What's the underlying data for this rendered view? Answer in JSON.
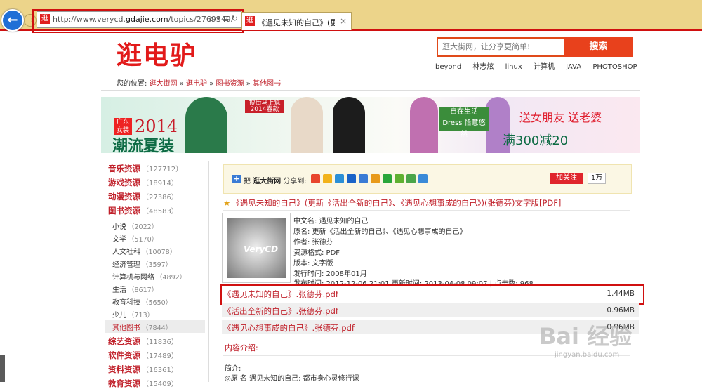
{
  "browser": {
    "url_prefix": "http://www.verycd.",
    "url_domain": "gdajie.com",
    "url_path": "/topics/2769349/",
    "tab_title": "《遇见未知的自己》(更新…",
    "back_glyph": "←",
    "forward_glyph": "→",
    "close_glyph": "×",
    "favicon_text": "逛",
    "addr_tools": "ρ ▾ ≣ ↻"
  },
  "header": {
    "logo": "逛电驴",
    "search_placeholder": "逛大街网，让分享更简单!",
    "search_button": "搜索",
    "hotwords": [
      "beyond",
      "林志炫",
      "linux",
      "计算机",
      "JAVA",
      "PHOTOSHOP"
    ]
  },
  "breadcrumb": {
    "prefix": "您的位置:",
    "items": [
      "逛大街网",
      "逛电驴",
      "图书资源",
      "其他图书"
    ],
    "separator": " » "
  },
  "banner": {
    "tag": "广东女装",
    "year": "2014",
    "title": "潮流夏装",
    "promo": "搜街马上疯 2014春款",
    "mid_text": "自在生活 Dress 恰意悠然",
    "right_line1": "送女朋友  送老婆",
    "right_line2": "满300减20"
  },
  "sidebar": {
    "categories": [
      {
        "name": "音乐资源",
        "count": "（127712）"
      },
      {
        "name": "游戏资源",
        "count": "（18914）"
      },
      {
        "name": "动漫资源",
        "count": "（27386）"
      },
      {
        "name": "图书资源",
        "count": "（48583）"
      }
    ],
    "subcategories": [
      {
        "name": "小说",
        "count": "（2022）"
      },
      {
        "name": "文学",
        "count": "（5170）"
      },
      {
        "name": "人文社科",
        "count": "（10078）"
      },
      {
        "name": "经济管理",
        "count": "（3597）"
      },
      {
        "name": "计算机与网络",
        "count": "（4892）"
      },
      {
        "name": "生活",
        "count": "（8617）"
      },
      {
        "name": "教育科技",
        "count": "（5650）"
      },
      {
        "name": "少儿",
        "count": "（713）"
      },
      {
        "name": "其他图书",
        "count": "（7844）"
      }
    ],
    "more_categories": [
      {
        "name": "综艺资源",
        "count": "（11836）"
      },
      {
        "name": "软件资源",
        "count": "（17489）"
      },
      {
        "name": "资料资源",
        "count": "（16361）"
      },
      {
        "name": "教育资源",
        "count": "（15409）"
      }
    ]
  },
  "share": {
    "prefix": "把",
    "site": "逛大街网",
    "suffix": "分享到:",
    "follow": "加关注",
    "follow_count": "1万",
    "icon_colors": [
      "#e8452c",
      "#f2b21a",
      "#2b8fd6",
      "#1a63c8",
      "#3a7bd5",
      "#e89a1a",
      "#2aa63a",
      "#5fb030",
      "#4aa54a",
      "#3a8ad8"
    ]
  },
  "resource": {
    "title": "《遇见未知的自己》(更新《活出全新的自己》、《遇见心想事成的自己》)(张德芬)文字版[PDF]",
    "cover_label": "VeryCD",
    "meta": [
      "中文名: 遇见未知的自己",
      "原名: 更新《活出全新的自己》、《遇见心想事成的自己》",
      "作者: 张德芬",
      "资源格式: PDF",
      "版本: 文字版",
      "发行时间: 2008年01月",
      "发布时间: 2012-12-06 21:01 更新时间: 2013-04-08 09:07 | 点击数: 968"
    ]
  },
  "files": [
    {
      "name": "《遇见未知的自己》.张德芬.pdf",
      "size": "1.44MB"
    },
    {
      "name": "《活出全新的自己》.张德芬.pdf",
      "size": "0.96MB"
    },
    {
      "name": "《遇见心想事成的自己》.张德芬.pdf",
      "size": "0.96MB"
    }
  ],
  "intro": {
    "title": "内容介绍:",
    "line1": "简介:",
    "line2": "◎原 名 遇见未知的自己: 都市身心灵修行课"
  },
  "watermark": {
    "main": "Bai 经验",
    "sub": "jingyan.baidu.com"
  }
}
